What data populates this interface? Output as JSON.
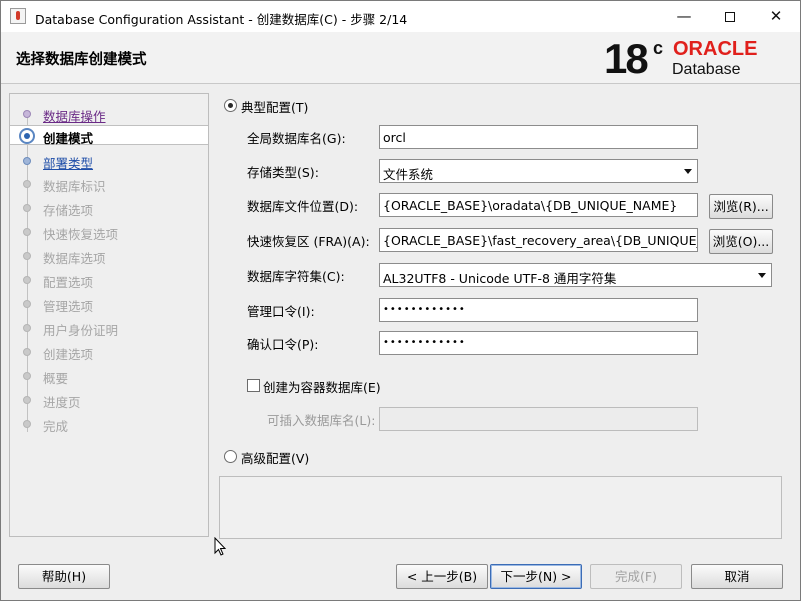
{
  "window": {
    "title": "Database Configuration Assistant - 创建数据库(C) - 步骤 2/14",
    "min": "—",
    "close": "✕"
  },
  "header": {
    "page_title": "选择数据库创建模式",
    "logo_number": "18",
    "logo_sup": "c",
    "logo_oracle": "ORACLE",
    "logo_product": "Database"
  },
  "nav": {
    "items": [
      {
        "label": "数据库操作",
        "state": "done"
      },
      {
        "label": "创建模式",
        "state": "current"
      },
      {
        "label": "部署类型",
        "state": "link"
      },
      {
        "label": "数据库标识",
        "state": "disabled"
      },
      {
        "label": "存储选项",
        "state": "disabled"
      },
      {
        "label": "快速恢复选项",
        "state": "disabled"
      },
      {
        "label": "数据库选项",
        "state": "disabled"
      },
      {
        "label": "配置选项",
        "state": "disabled"
      },
      {
        "label": "管理选项",
        "state": "disabled"
      },
      {
        "label": "用户身份证明",
        "state": "disabled"
      },
      {
        "label": "创建选项",
        "state": "disabled"
      },
      {
        "label": "概要",
        "state": "disabled"
      },
      {
        "label": "进度页",
        "state": "disabled"
      },
      {
        "label": "完成",
        "state": "disabled"
      }
    ]
  },
  "form": {
    "typical_label": "典型配置(T)",
    "typical_selected": true,
    "global_db_name_label": "全局数据库名(G):",
    "global_db_name_value": "orcl",
    "storage_type_label": "存储类型(S):",
    "storage_type_value": "文件系统",
    "db_file_location_label": "数据库文件位置(D):",
    "db_file_location_value": "{ORACLE_BASE}\\oradata\\{DB_UNIQUE_NAME}",
    "browse_r_label": "浏览(R)...",
    "fra_label": "快速恢复区 (FRA)(A):",
    "fra_value": "{ORACLE_BASE}\\fast_recovery_area\\{DB_UNIQUE_NAME}",
    "browse_o_label": "浏览(O)...",
    "charset_label": "数据库字符集(C):",
    "charset_value": "AL32UTF8 - Unicode UTF-8 通用字符集",
    "admin_pw_label": "管理口令(I):",
    "admin_pw_value": "••••••••••••",
    "confirm_pw_label": "确认口令(P):",
    "confirm_pw_value": "••••••••••••",
    "container_db_label": "创建为容器数据库(E)",
    "container_db_checked": false,
    "pdb_name_label": "可插入数据库名(L):",
    "pdb_name_value": "",
    "advanced_label": "高级配置(V)",
    "advanced_selected": false
  },
  "footer": {
    "help": "帮助(H)",
    "back": "< 上一步(B)",
    "next": "下一步(N) >",
    "finish": "完成(F)",
    "cancel": "取消"
  }
}
